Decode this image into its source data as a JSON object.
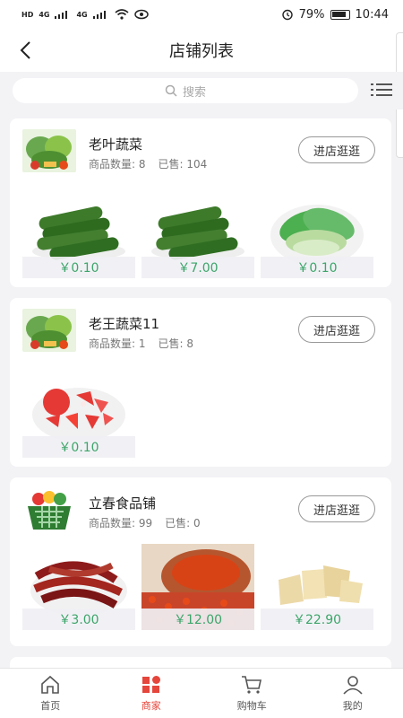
{
  "status_bar": {
    "network_labels": [
      "HD",
      "4G",
      "4G"
    ],
    "battery_percent": "79%",
    "time": "10:44"
  },
  "nav": {
    "title": "店铺列表"
  },
  "search": {
    "placeholder": "搜索"
  },
  "shops": [
    {
      "name": "老叶蔬菜",
      "product_count_label": "商品数量: 8",
      "sold_label": "已售: 104",
      "visit_label": "进店逛逛",
      "products": [
        {
          "image": "cucumber",
          "price": "￥0.10"
        },
        {
          "image": "cucumber",
          "price": "￥7.00"
        },
        {
          "image": "bok-choy",
          "price": "￥0.10"
        }
      ]
    },
    {
      "name": "老王蔬菜11",
      "product_count_label": "商品数量: 1",
      "sold_label": "已售: 8",
      "visit_label": "进店逛逛",
      "products": [
        {
          "image": "tomato",
          "price": "￥0.10"
        }
      ]
    },
    {
      "name": "立春食品铺",
      "product_count_label": "商品数量: 99",
      "sold_label": "已售: 0",
      "visit_label": "进店逛逛",
      "products": [
        {
          "image": "chili",
          "price": "￥3.00"
        },
        {
          "image": "goji",
          "price": "￥12.00"
        },
        {
          "image": "tofu-skin",
          "price": "￥22.90"
        }
      ]
    }
  ],
  "tabs": [
    {
      "label": "首页",
      "icon": "home-icon",
      "active": false
    },
    {
      "label": "商家",
      "icon": "shop-icon",
      "active": true
    },
    {
      "label": "购物车",
      "icon": "cart-icon",
      "active": false
    },
    {
      "label": "我的",
      "icon": "user-icon",
      "active": false
    }
  ],
  "colors": {
    "accent": "#e5453b",
    "price": "#3ca56a",
    "background": "#f3f3f6"
  }
}
